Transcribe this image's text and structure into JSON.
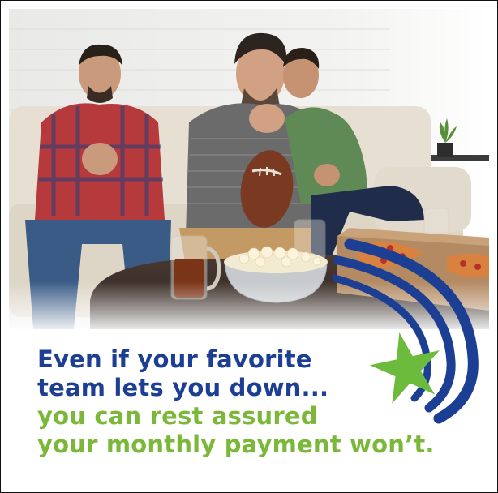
{
  "caption": {
    "line1": "Even if your favorite",
    "line2": "team lets you down...",
    "line3": "you can rest assured",
    "line4": "your monthly payment won’t."
  },
  "colors": {
    "headline_blue": "#1c3f94",
    "headline_green": "#7bb83a",
    "star_green": "#6dbb3c",
    "swoosh_blue": "#1c3f94"
  },
  "photo": {
    "subject": "three-men-watching-game-on-sofa",
    "icons": [
      "football-icon",
      "popcorn-bowl-icon",
      "beer-mug-icon",
      "pizza-box-icon",
      "plant-icon"
    ]
  }
}
